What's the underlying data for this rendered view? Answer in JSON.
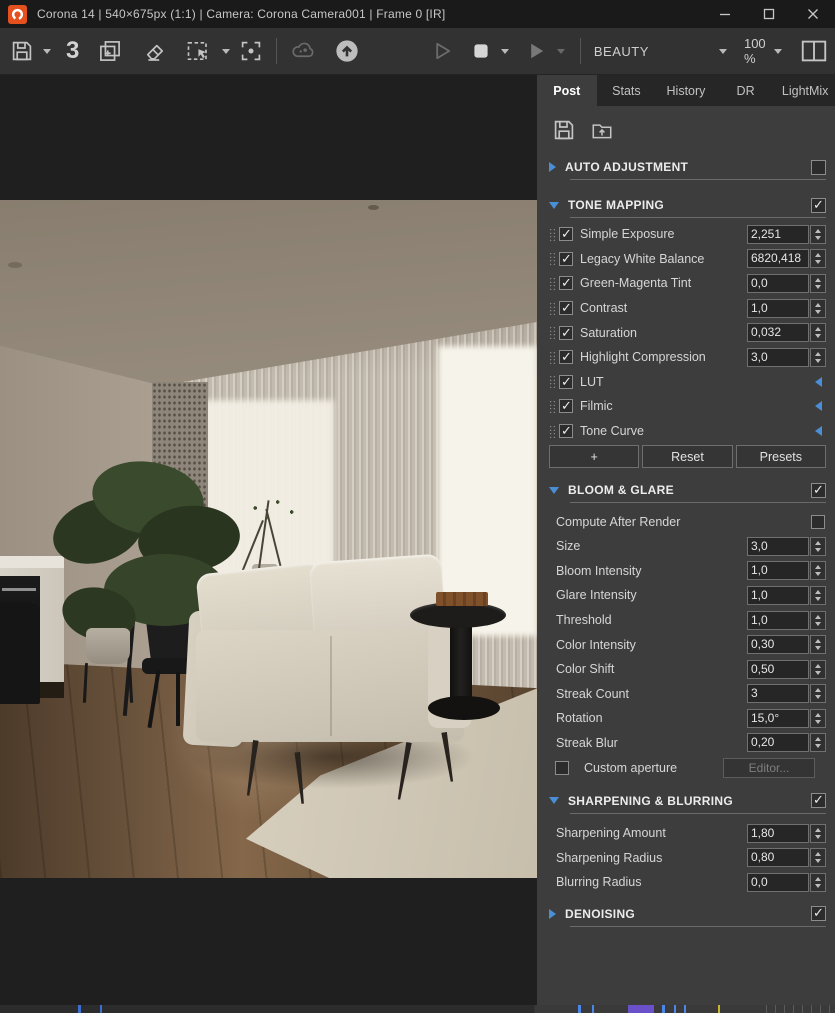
{
  "titlebar": {
    "title": "Corona 14 | 540×675px (1:1) | Camera: Corona Camera001 | Frame 0 [IR]"
  },
  "toolbar": {
    "max_button_label": "3",
    "aov_selected": "BEAUTY",
    "zoom_level": "100 %"
  },
  "tabs": {
    "items": [
      "Post",
      "Stats",
      "History",
      "DR",
      "LightMix"
    ]
  },
  "post": {
    "auto_adjustment": {
      "title": "AUTO ADJUSTMENT",
      "expanded": false,
      "checked": false
    },
    "tone_mapping": {
      "title": "TONE MAPPING",
      "checked": true,
      "rows": [
        {
          "label": "Simple Exposure",
          "value": "2,251",
          "checked": true
        },
        {
          "label": "Legacy White Balance",
          "value": "6820,418",
          "checked": true
        },
        {
          "label": "Green-Magenta Tint",
          "value": "0,0",
          "checked": true
        },
        {
          "label": "Contrast",
          "value": "1,0",
          "checked": true
        },
        {
          "label": "Saturation",
          "value": "0,032",
          "checked": true
        },
        {
          "label": "Highlight Compression",
          "value": "3,0",
          "checked": true
        }
      ],
      "group_rows": [
        {
          "label": "LUT",
          "checked": true
        },
        {
          "label": "Filmic",
          "checked": true
        },
        {
          "label": "Tone Curve",
          "checked": true
        }
      ],
      "buttons": [
        "+",
        "Reset",
        "Presets"
      ]
    },
    "bloom_glare": {
      "title": "BLOOM & GLARE",
      "checked": true,
      "compute_after_render_label": "Compute After Render",
      "rows": [
        {
          "label": "Size",
          "value": "3,0"
        },
        {
          "label": "Bloom Intensity",
          "value": "1,0"
        },
        {
          "label": "Glare Intensity",
          "value": "1,0"
        },
        {
          "label": "Threshold",
          "value": "1,0"
        },
        {
          "label": "Color Intensity",
          "value": "0,30"
        },
        {
          "label": "Color Shift",
          "value": "0,50"
        },
        {
          "label": "Streak Count",
          "value": "3"
        },
        {
          "label": "Rotation",
          "value": "15,0°"
        },
        {
          "label": "Streak Blur",
          "value": "0,20"
        }
      ],
      "custom_aperture_label": "Custom aperture",
      "editor_button_label": "Editor..."
    },
    "sharpening_blurring": {
      "title": "SHARPENING & BLURRING",
      "checked": true,
      "rows": [
        {
          "label": "Sharpening Amount",
          "value": "1,80"
        },
        {
          "label": "Sharpening Radius",
          "value": "0,80"
        },
        {
          "label": "Blurring Radius",
          "value": "0,0"
        }
      ]
    },
    "denoising": {
      "title": "DENOISING",
      "expanded": false,
      "checked": true
    }
  }
}
